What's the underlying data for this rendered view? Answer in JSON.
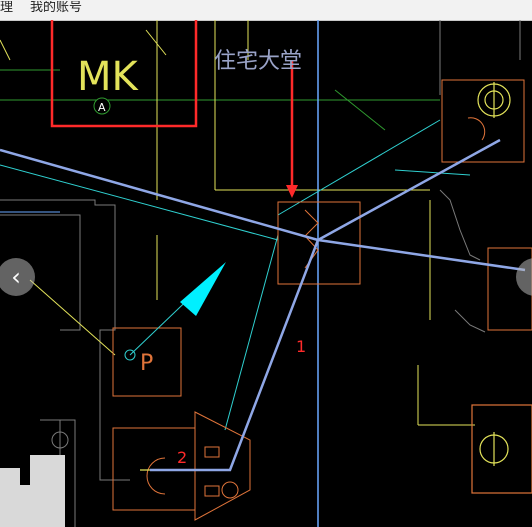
{
  "topbar": {
    "left_fragment": "理",
    "title": "我的账号"
  },
  "drawing": {
    "label_mk": "MK",
    "label_a": "A",
    "label_lobby": "住宅大堂",
    "label_p": "P",
    "label_1": "1",
    "label_2": "2"
  },
  "nav": {
    "prev_icon": "chevron-left-icon",
    "next_icon": "chevron-right-icon"
  },
  "colors": {
    "highlight_box": "#ff2a2a",
    "route_line": "#8fa7e6",
    "arrow_cyan": "#00f0ff",
    "cad_yellow": "#e3e35a",
    "cad_orange": "#e0743a",
    "cad_green": "#2f9a2f",
    "cad_cyan_line": "#2fd0d0",
    "cad_blue_axis": "#6aa8ff"
  }
}
